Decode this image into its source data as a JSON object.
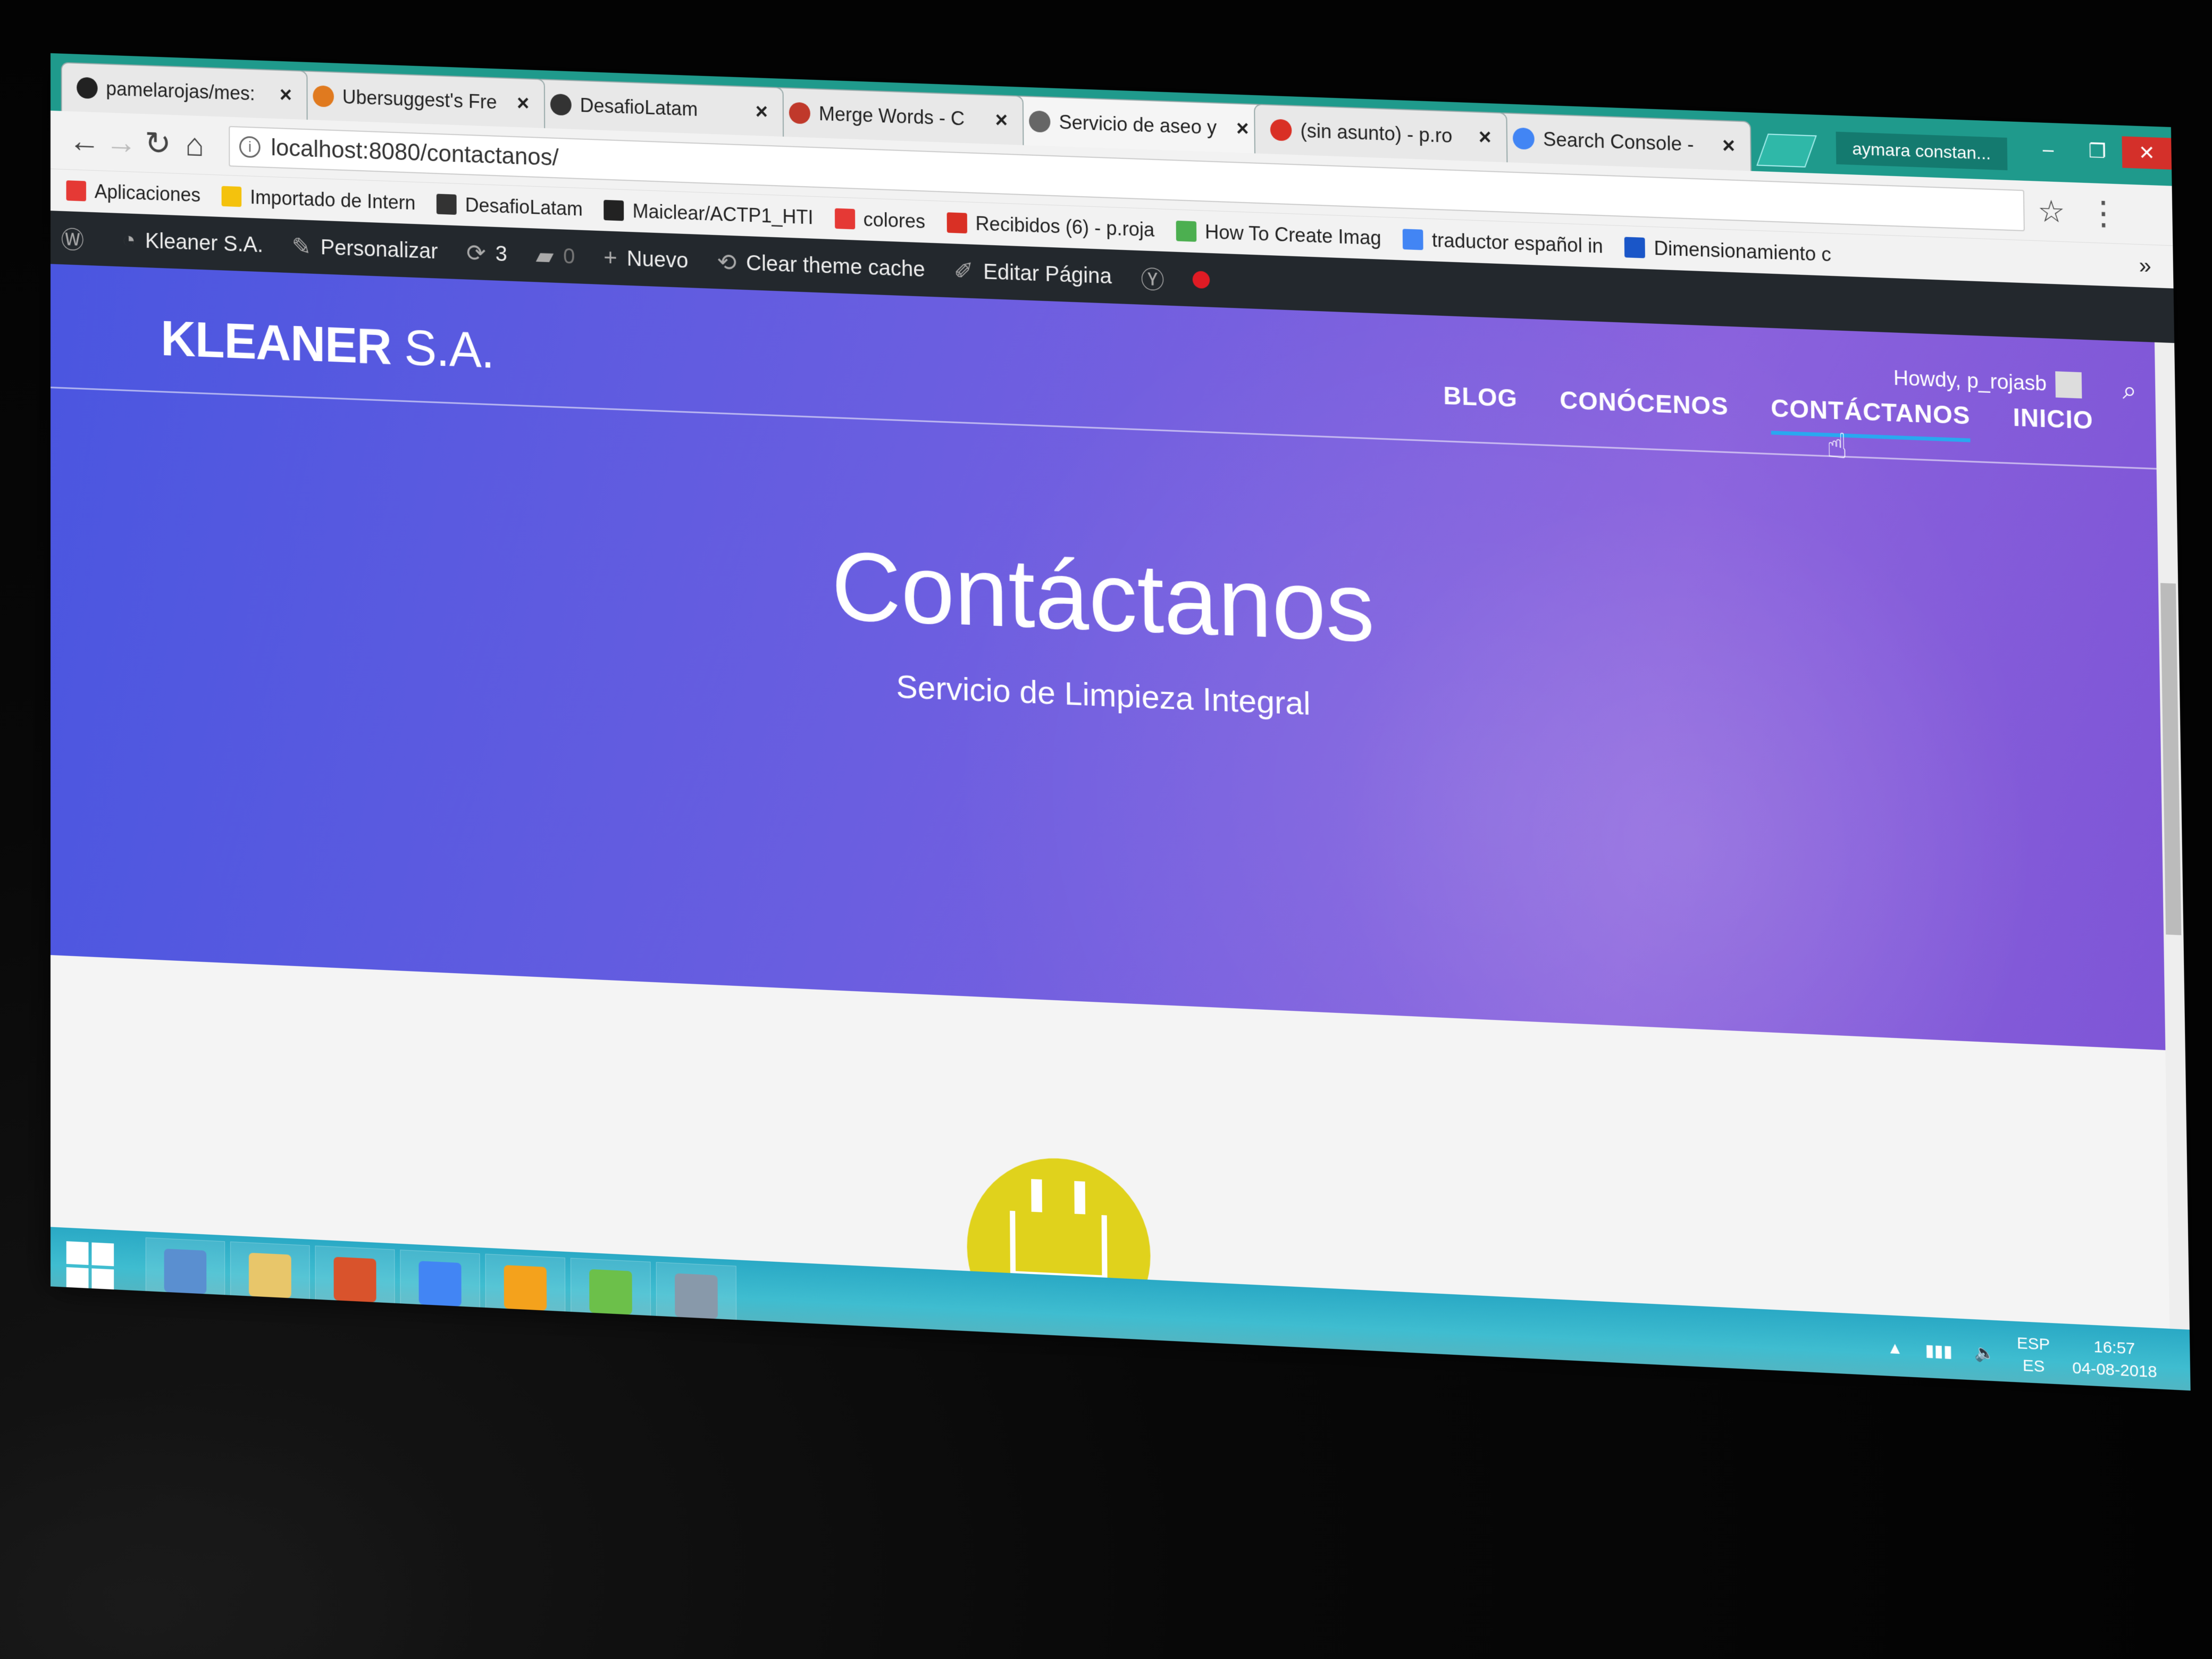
{
  "browser": {
    "tabs": [
      {
        "title": "pamelarojas/mes:",
        "icon": "github-icon",
        "color": "#222222"
      },
      {
        "title": "Ubersuggest's Fre",
        "icon": "ubersuggest-icon",
        "color": "#e07a1f"
      },
      {
        "title": "DesafioLatam",
        "icon": "desafiolatam-icon",
        "color": "#333333"
      },
      {
        "title": "Merge Words - C",
        "icon": "merge-words-icon",
        "color": "#c0392b"
      },
      {
        "title": "Servicio de aseo y",
        "icon": "page-icon",
        "color": "#666666",
        "active": true
      },
      {
        "title": "(sin asunto) - p.ro",
        "icon": "gmail-icon",
        "color": "#d93025"
      },
      {
        "title": "Search Console -",
        "icon": "search-console-icon",
        "color": "#4285f4"
      }
    ],
    "profile_name": "aymara constan...",
    "address": "localhost:8080/contactanos/",
    "bookmarks": [
      {
        "label": "Aplicaciones",
        "icon": "apps-grid-icon",
        "color": "#e53935"
      },
      {
        "label": "Importado de Intern",
        "icon": "folder-icon",
        "color": "#f4c20d"
      },
      {
        "label": "DesafioLatam",
        "icon": "desafiolatam-icon",
        "color": "#333333"
      },
      {
        "label": "Maiclear/ACTP1_HTI",
        "icon": "github-icon",
        "color": "#222222"
      },
      {
        "label": "colores",
        "icon": "adobe-icon",
        "color": "#e53935"
      },
      {
        "label": "Recibidos (6) - p.roja",
        "icon": "gmail-icon",
        "color": "#d93025"
      },
      {
        "label": "How To Create Imag",
        "icon": "w3schools-icon",
        "color": "#4caf50"
      },
      {
        "label": "traductor español in",
        "icon": "google-icon",
        "color": "#4285f4"
      },
      {
        "label": "Dimensionamiento c",
        "icon": "flag-icon",
        "color": "#1a56c8"
      }
    ],
    "bookmarks_more": "»"
  },
  "wp_admin_bar": {
    "site_name": "Kleaner S.A.",
    "customize": "Personalizar",
    "updates_count": "3",
    "comments_count": "0",
    "new_label": "Nuevo",
    "clear_cache": "Clear theme cache",
    "edit_page": "Editar Página"
  },
  "site": {
    "logo_bold": "KLEANER",
    "logo_light": "S.A.",
    "howdy": "Howdy, p_rojasb",
    "nav": [
      {
        "label": "BLOG",
        "active": false
      },
      {
        "label": "CONÓCENOS",
        "active": false
      },
      {
        "label": "CONTÁCTANOS",
        "active": true
      },
      {
        "label": "INICIO",
        "active": false
      }
    ],
    "hero_title": "Contáctanos",
    "hero_subtitle": "Servicio de Limpieza Integral",
    "accent_color": "#29a8f0",
    "badge_color": "#e0d21c"
  },
  "taskbar": {
    "apps": [
      {
        "icon": "photos-icon",
        "color": "#5a8fd0"
      },
      {
        "icon": "file-explorer-icon",
        "color": "#e8c66a"
      },
      {
        "icon": "office-icon",
        "color": "#d9532c"
      },
      {
        "icon": "chrome-icon",
        "color": "#4285f4"
      },
      {
        "icon": "sublime-text-icon",
        "color": "#f4a21c"
      },
      {
        "icon": "git-icon",
        "color": "#6cc04a"
      },
      {
        "icon": "app-circle-icon",
        "color": "#8899aa"
      }
    ],
    "lang_top": "ESP",
    "lang_bottom": "ES",
    "time": "16:57",
    "date": "04-08-2018"
  }
}
